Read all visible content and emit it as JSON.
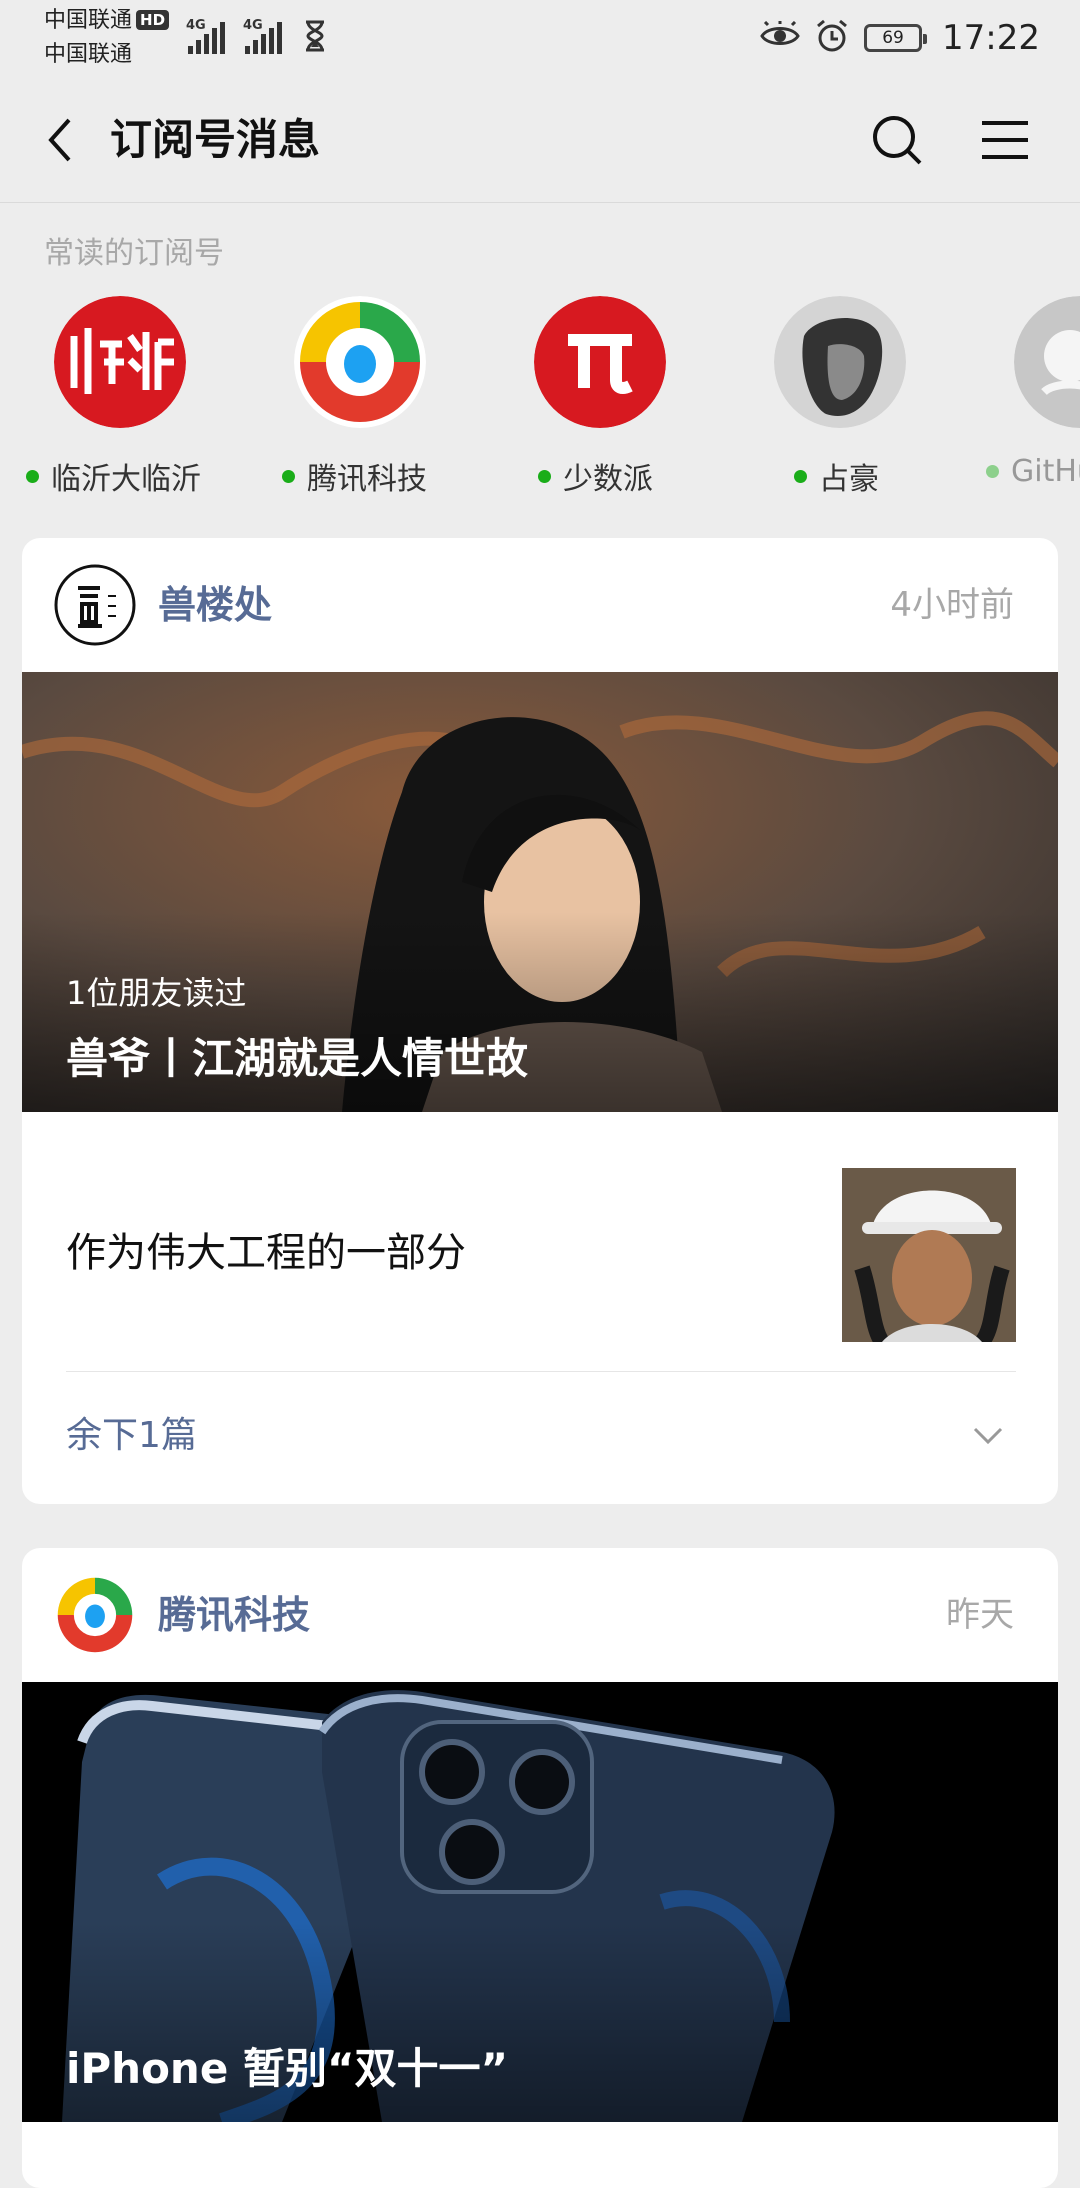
{
  "status_bar": {
    "carrier_1": "中国联通",
    "hd_badge": "HD",
    "carrier_2": "中国联通",
    "network_1": "4G",
    "network_2": "4G",
    "battery": "69",
    "time": "17:22"
  },
  "header": {
    "title": "订阅号消息"
  },
  "frequent": {
    "label": "常读的订阅号",
    "items": [
      {
        "name": "临沂大临沂"
      },
      {
        "name": "腾讯科技"
      },
      {
        "name": "少数派"
      },
      {
        "name": "占豪"
      },
      {
        "name": "GitHu"
      }
    ]
  },
  "cards": [
    {
      "account": "兽楼处",
      "time": "4小时前",
      "cover_readers": "1位朋友读过",
      "cover_title": "兽爷丨江湖就是人情世故",
      "sub_title": "作为伟大工程的一部分",
      "more": "余下1篇"
    },
    {
      "account": "腾讯科技",
      "time": "昨天",
      "cover_title": "iPhone 暂别“双十一”"
    }
  ],
  "colors": {
    "accent_link": "#576b95",
    "online_dot": "#1aad19",
    "background": "#ededed"
  }
}
